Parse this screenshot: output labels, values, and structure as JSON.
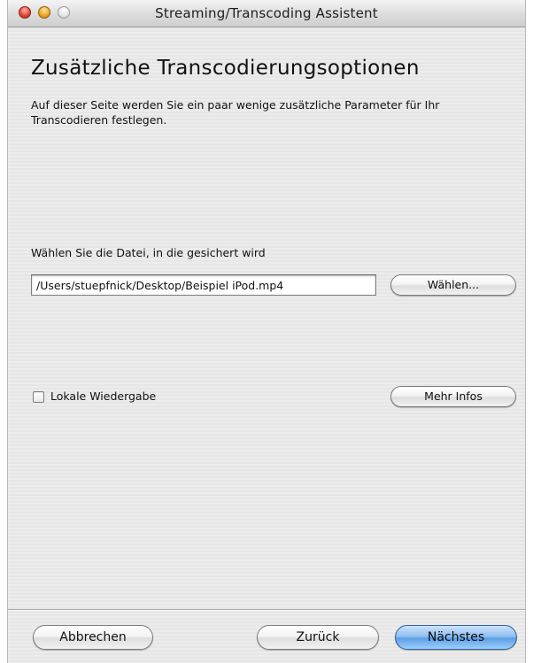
{
  "window": {
    "title": "Streaming/Transcoding Assistent"
  },
  "page": {
    "heading": "Zusätzliche Transcodierungsoptionen",
    "description": "Auf dieser Seite werden Sie ein paar wenige zusätzliche Parameter für Ihr Transcodieren festlegen."
  },
  "file": {
    "label": "Wählen Sie die Datei, in die gesichert wird",
    "path": "/Users/stuepfnick/Desktop/Beispiel iPod.mp4",
    "choose_label": "Wählen..."
  },
  "options": {
    "local_playback_label": "Lokale Wiedergabe",
    "local_playback_checked": false,
    "more_info_label": "Mehr Infos"
  },
  "footer": {
    "cancel_label": "Abbrechen",
    "back_label": "Zurück",
    "next_label": "Nächstes"
  },
  "colors": {
    "default_button": "#6aa8ea",
    "window_background": "#ececec",
    "close_light": "#e24b3c",
    "minimize_light": "#f0a72a"
  }
}
